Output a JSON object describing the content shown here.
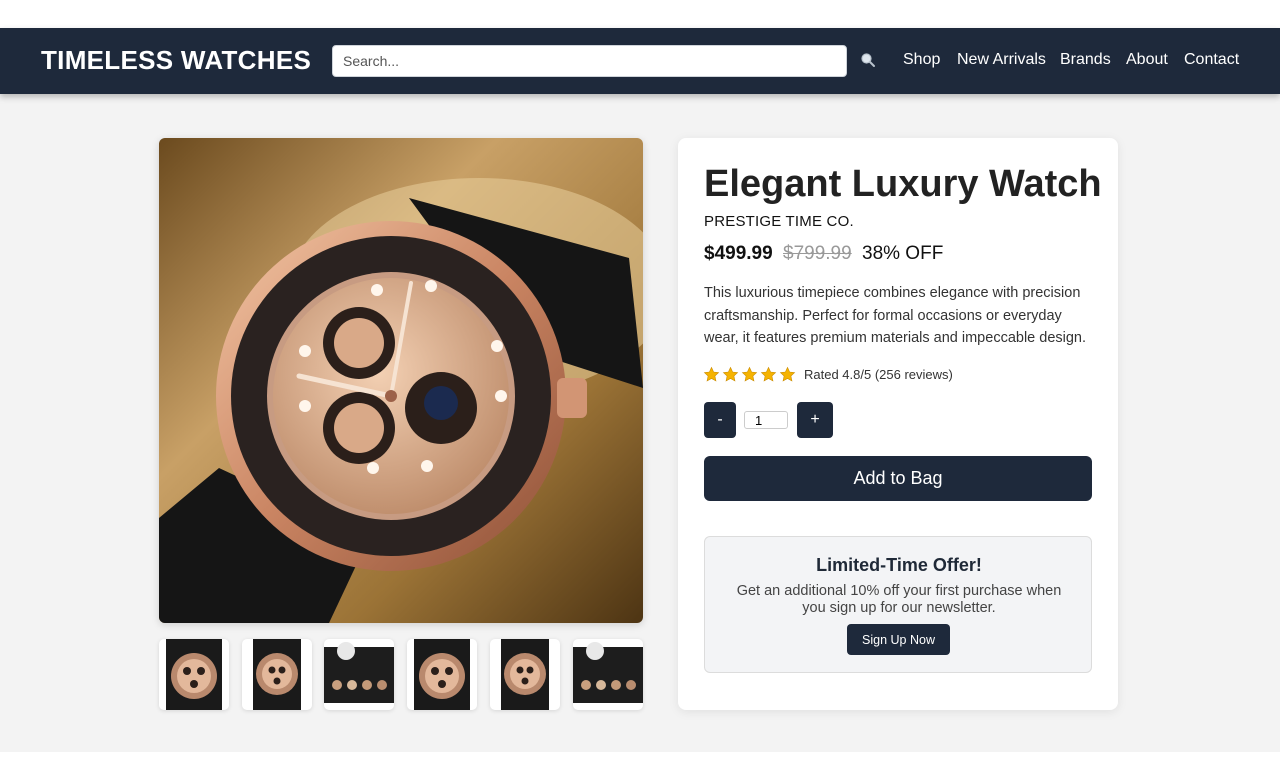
{
  "header": {
    "logo": "TIMELESS WATCHES",
    "search_placeholder": "Search...",
    "search_icon": "magnifier-icon",
    "nav": [
      "Shop",
      "New Arrivals",
      "Brands",
      "About",
      "Contact"
    ]
  },
  "product": {
    "title": "Elegant Luxury Watch",
    "brand": "PRESTIGE TIME CO.",
    "price": "$499.99",
    "original_price": "$799.99",
    "discount": "38% OFF",
    "description": "This luxurious timepiece combines elegance with precision craftsmanship. Perfect for formal occasions or everyday wear, it features premium materials and impeccable design.",
    "rating_stars": 5,
    "rating_text": "Rated 4.8/5 (256 reviews)",
    "quantity": "1",
    "decrement_label": "-",
    "increment_label": "+",
    "add_to_bag_label": "Add to Bag",
    "thumbnails": [
      "watch-front-thumb",
      "watch-strap-thumb",
      "watch-lineup-thumb",
      "watch-front-thumb",
      "watch-strap-thumb",
      "watch-lineup-thumb"
    ]
  },
  "offer": {
    "title": "Limited-Time Offer!",
    "text": "Get an additional 10% off your first purchase when you sign up for our newsletter.",
    "button_label": "Sign Up Now"
  },
  "colors": {
    "header_bg": "#1e293b",
    "page_bg": "#f3f3f3",
    "accent_button": "#1e293b",
    "star": "#f5b301"
  }
}
